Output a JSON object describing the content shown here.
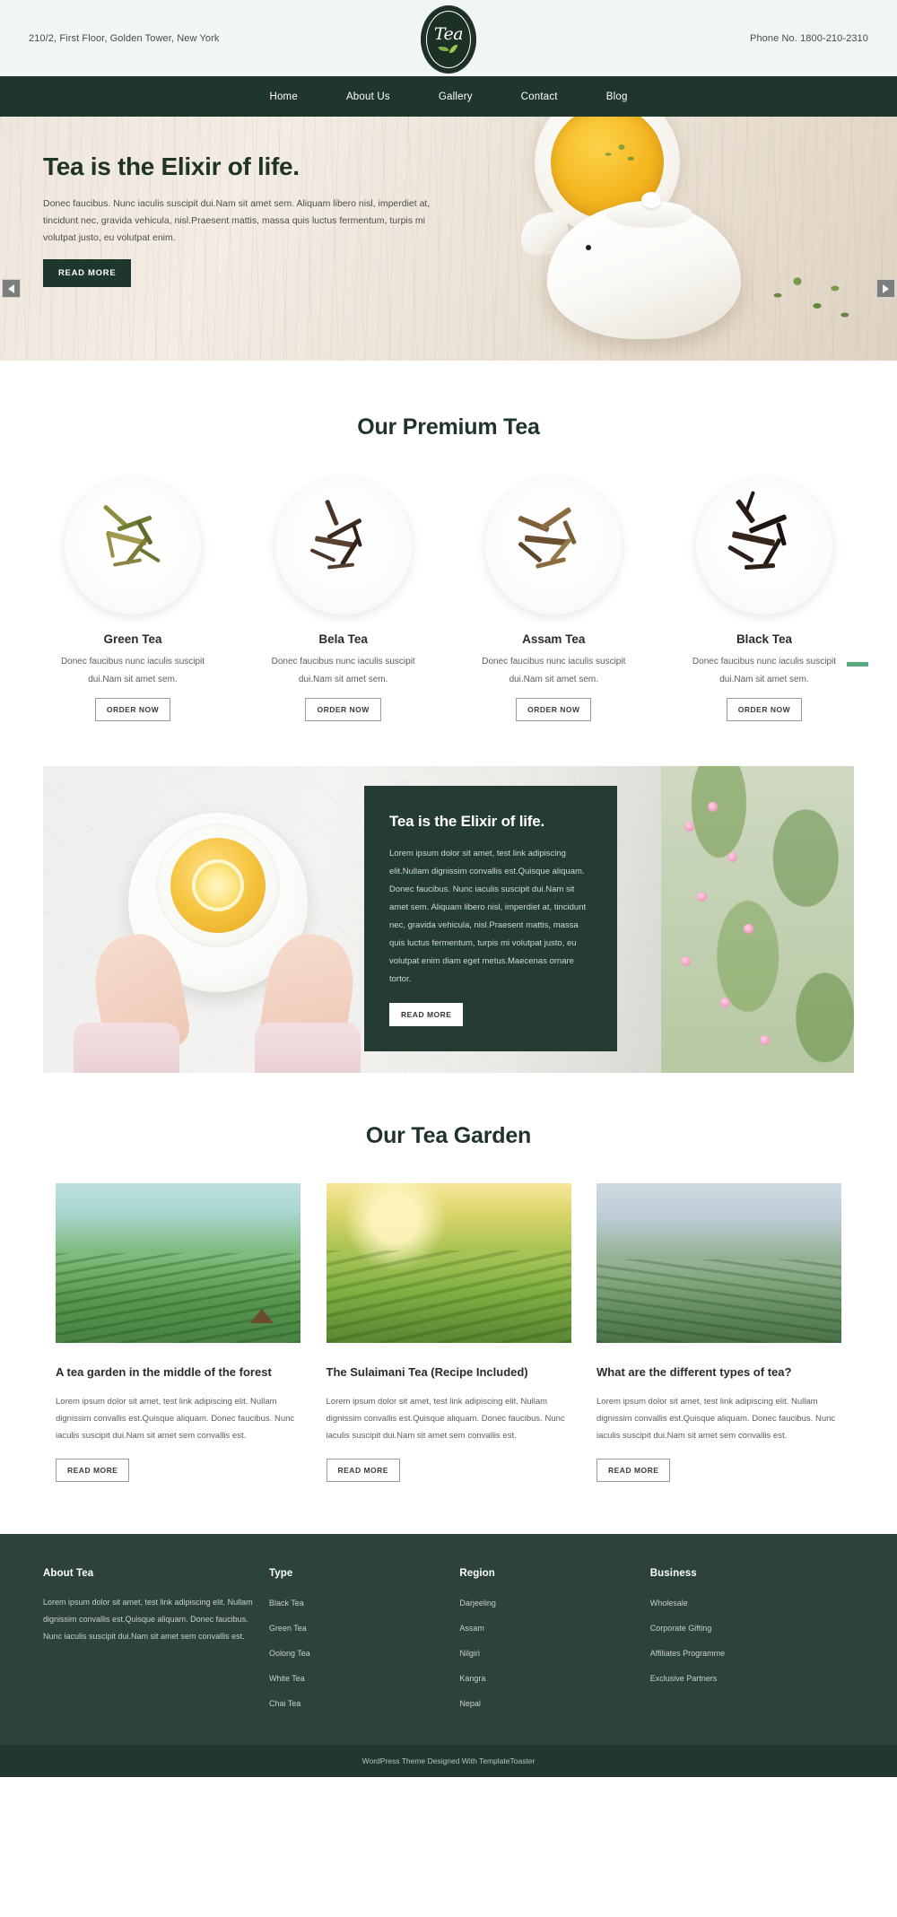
{
  "topbar": {
    "address": "210/2, First Floor, Golden Tower, New York",
    "phone": "Phone No. 1800-210-2310",
    "logo_text": "Tea"
  },
  "nav": {
    "items": [
      {
        "label": "Home"
      },
      {
        "label": "About Us"
      },
      {
        "label": "Gallery"
      },
      {
        "label": "Contact"
      },
      {
        "label": "Blog"
      }
    ]
  },
  "hero": {
    "title": "Tea is the Elixir of life.",
    "description": "Donec faucibus. Nunc iaculis suscipit dui.Nam sit amet sem. Aliquam libero nisl, imperdiet at, tincidunt nec, gravida vehicula, nisl.Praesent mattis, massa quis luctus fermentum, turpis mi volutpat justo, eu volutpat enim.",
    "button": "READ MORE",
    "prev_label": "Previous slide",
    "next_label": "Next slide"
  },
  "premium": {
    "title": "Our Premium Tea",
    "cards": [
      {
        "name": "Green Tea",
        "desc": "Donec faucibus nunc iaculis suscipit dui.Nam sit amet sem.",
        "button": "ORDER NOW"
      },
      {
        "name": "Bela Tea",
        "desc": "Donec faucibus nunc iaculis suscipit dui.Nam sit amet sem.",
        "button": "ORDER NOW"
      },
      {
        "name": "Assam Tea",
        "desc": "Donec faucibus nunc iaculis suscipit dui.Nam sit amet sem.",
        "button": "ORDER NOW"
      },
      {
        "name": "Black Tea",
        "desc": "Donec faucibus nunc iaculis suscipit dui.Nam sit amet sem.",
        "button": "ORDER NOW"
      }
    ]
  },
  "feature": {
    "title": "Tea is the Elixir of life.",
    "description": "Lorem ipsum dolor sit amet, test link adipiscing elit.Nullam dignissim convallis est.Quisque aliquam. Donec faucibus. Nunc iaculis suscipit dui.Nam sit amet sem. Aliquam libero nisl, imperdiet at, tincidunt nec, gravida vehicula, nisl.Praesent mattis, massa quis luctus fermentum, turpis mi volutpat justo, eu volutpat enim diam eget metus.Maecenas ornare tortor.",
    "button": "READ MORE"
  },
  "garden": {
    "title": "Our Tea Garden",
    "posts": [
      {
        "title": "A tea garden in the middle of the forest",
        "desc": "Lorem ipsum dolor sit amet, test link adipiscing elit. Nullam dignissim convallis est.Quisque aliquam. Donec faucibus. Nunc iaculis suscipit dui.Nam sit amet sem convallis est.",
        "button": "READ MORE"
      },
      {
        "title": "The Sulaimani Tea (Recipe Included)",
        "desc": "Lorem ipsum dolor sit amet, test link adipiscing elit. Nullam dignissim convallis est.Quisque aliquam. Donec faucibus. Nunc iaculis suscipit dui.Nam sit amet sem convallis est.",
        "button": "READ MORE"
      },
      {
        "title": "What are the different types of tea?",
        "desc": "Lorem ipsum dolor sit amet, test link adipiscing elit. Nullam dignissim convallis est.Quisque aliquam. Donec faucibus. Nunc iaculis suscipit dui.Nam sit amet sem convallis est.",
        "button": "READ MORE"
      }
    ]
  },
  "footer": {
    "about": {
      "heading": "About Tea",
      "text": "Lorem ipsum dolor sit amet, test link adipiscing elit. Nullam dignissim convallis est.Quisque aliquam. Donec faucibus. Nunc iaculis suscipit dui.Nam sit amet sem convallis est."
    },
    "type": {
      "heading": "Type",
      "items": [
        "Black Tea",
        "Green Tea",
        "Oolong Tea",
        "White Tea",
        "Chai Tea"
      ]
    },
    "region": {
      "heading": "Region",
      "items": [
        "Darjeeling",
        "Assam",
        "Nilgiri",
        "Kangra",
        "Nepal"
      ]
    },
    "business": {
      "heading": "Business",
      "items": [
        "Wholesale",
        "Corporate Gifting",
        "Affiliates Programme",
        "Exclusive Partners"
      ]
    },
    "copyright": "WordPress Theme Designed With TemplateToaster"
  },
  "colors": {
    "brand_dark": "#1f362c",
    "footer_bg": "#2d423a",
    "copyright_bg": "#223730",
    "accent_green": "#5aab84",
    "topbar_bg": "#f1f5f5"
  }
}
